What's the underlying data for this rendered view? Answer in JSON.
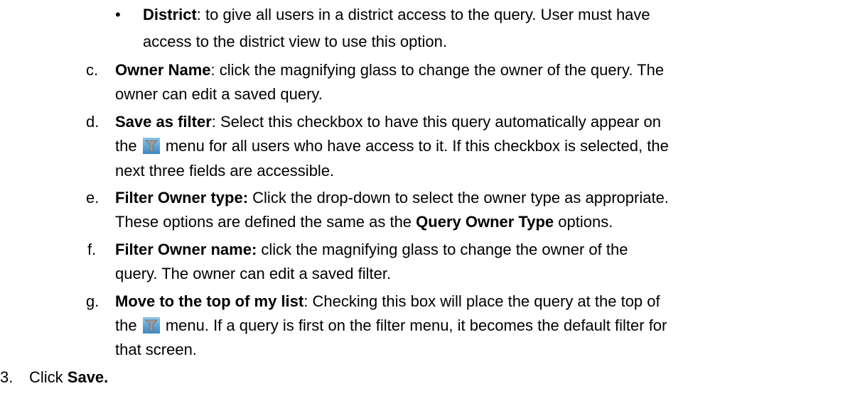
{
  "bullet_district": {
    "marker": "•",
    "line1_bold": "District",
    "line1_rest": ": to give all users in a district access to the query.  User must have",
    "line2": "access to the district view to use this option."
  },
  "items": {
    "c": {
      "marker": "c.",
      "bold": "Owner Name",
      "line1_rest": ":  click the magnifying glass to change the owner of the query.  The",
      "line2": "owner can edit a saved query."
    },
    "d": {
      "marker": "d.",
      "bold": "Save as filter",
      "line1_rest": ":  Select this checkbox to have this query automatically appear on",
      "line2_before_icon": "the ",
      "line2_after_icon": " menu for all users who have access to it.  If this checkbox is selected, the",
      "line3": "next three fields are accessible."
    },
    "e": {
      "marker": "e.",
      "bold": "Filter Owner type:",
      "line1_rest": "  Click the drop-down to select the owner type as appropriate.",
      "line2_before_bold": "These options are defined the same as the ",
      "line2_bold": "Query Owner Type",
      "line2_after_bold": " options."
    },
    "f": {
      "marker": "f.",
      "bold": "Filter Owner name:",
      "line1_rest": "  click the magnifying glass to change the owner of the",
      "line2": "query.  The owner can edit a saved filter."
    },
    "g": {
      "marker": "g.",
      "bold": "Move to the top of my list",
      "line1_rest": ":  Checking this box will place the query at the top of",
      "line2_before_icon": "the ",
      "line2_after_icon": " menu.  If a query is first on the filter menu, it becomes the default filter for",
      "line3": "that screen."
    }
  },
  "step3": {
    "marker": "3.",
    "before_bold": "Click ",
    "bold": "Save."
  },
  "icons": {
    "filter_icon": "funnel-filter-icon",
    "icon_bg_top": "#8cc6e8",
    "icon_bg_bottom": "#3a86c4",
    "icon_funnel": "#9a9a9a"
  }
}
